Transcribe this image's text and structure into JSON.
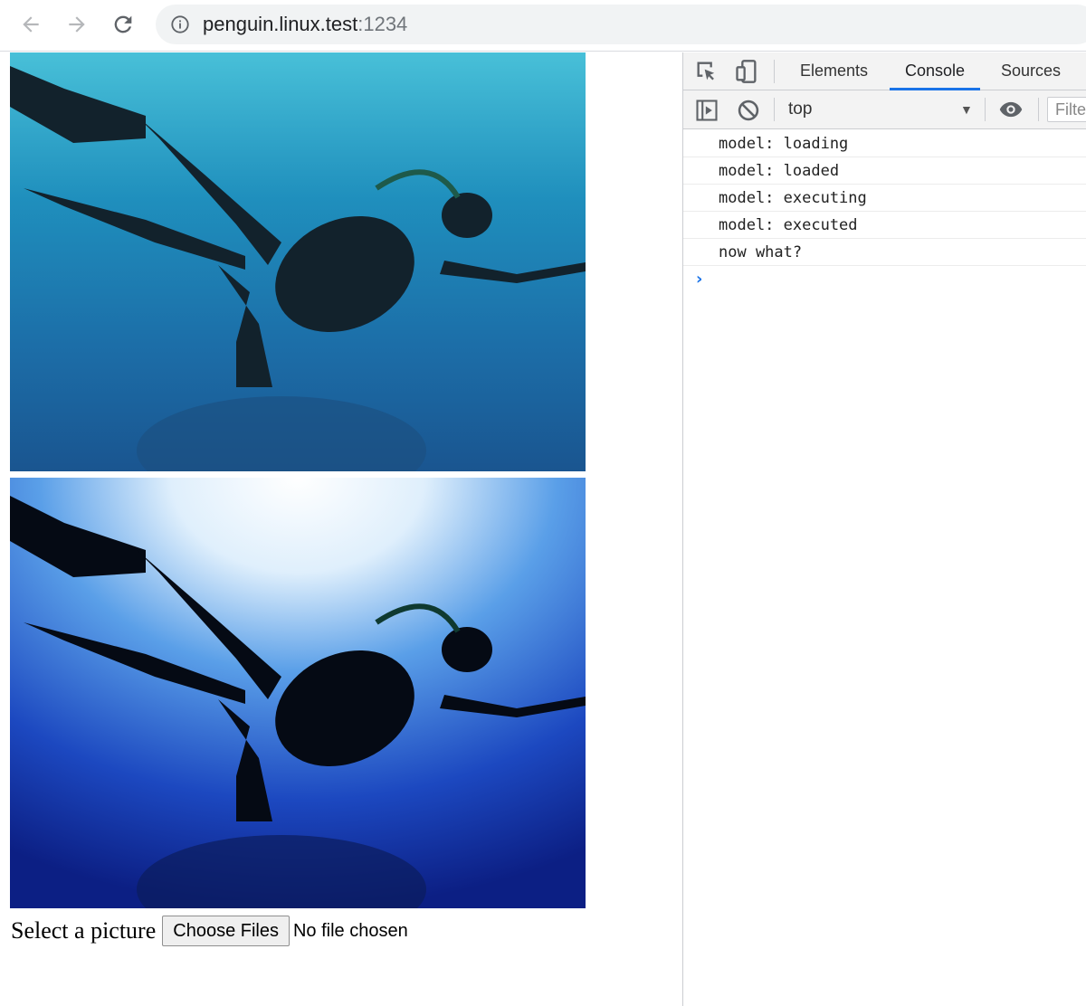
{
  "browser": {
    "url_host": "penguin.linux.test",
    "url_port": ":1234",
    "nav": {
      "back_icon": "arrow-left-icon",
      "forward_icon": "arrow-right-icon",
      "reload_icon": "reload-icon",
      "info_icon": "info-icon"
    }
  },
  "page": {
    "images": [
      {
        "name": "original-diver-photo",
        "style": "natural blue underwater"
      },
      {
        "name": "processed-diver-photo",
        "style": "high-contrast deep blue"
      }
    ],
    "file_input": {
      "label": "Select a picture",
      "button_label": "Choose Files",
      "status": "No file chosen"
    }
  },
  "devtools": {
    "tabs": [
      {
        "label": "Elements",
        "active": false
      },
      {
        "label": "Console",
        "active": true
      },
      {
        "label": "Sources",
        "active": false
      }
    ],
    "console_bar": {
      "context": "top",
      "filter_placeholder": "Filter"
    },
    "console_lines": [
      "model: loading",
      "model: loaded",
      "model: executing",
      "model: executed",
      "now what?"
    ],
    "accent_color": "#1a73e8"
  }
}
